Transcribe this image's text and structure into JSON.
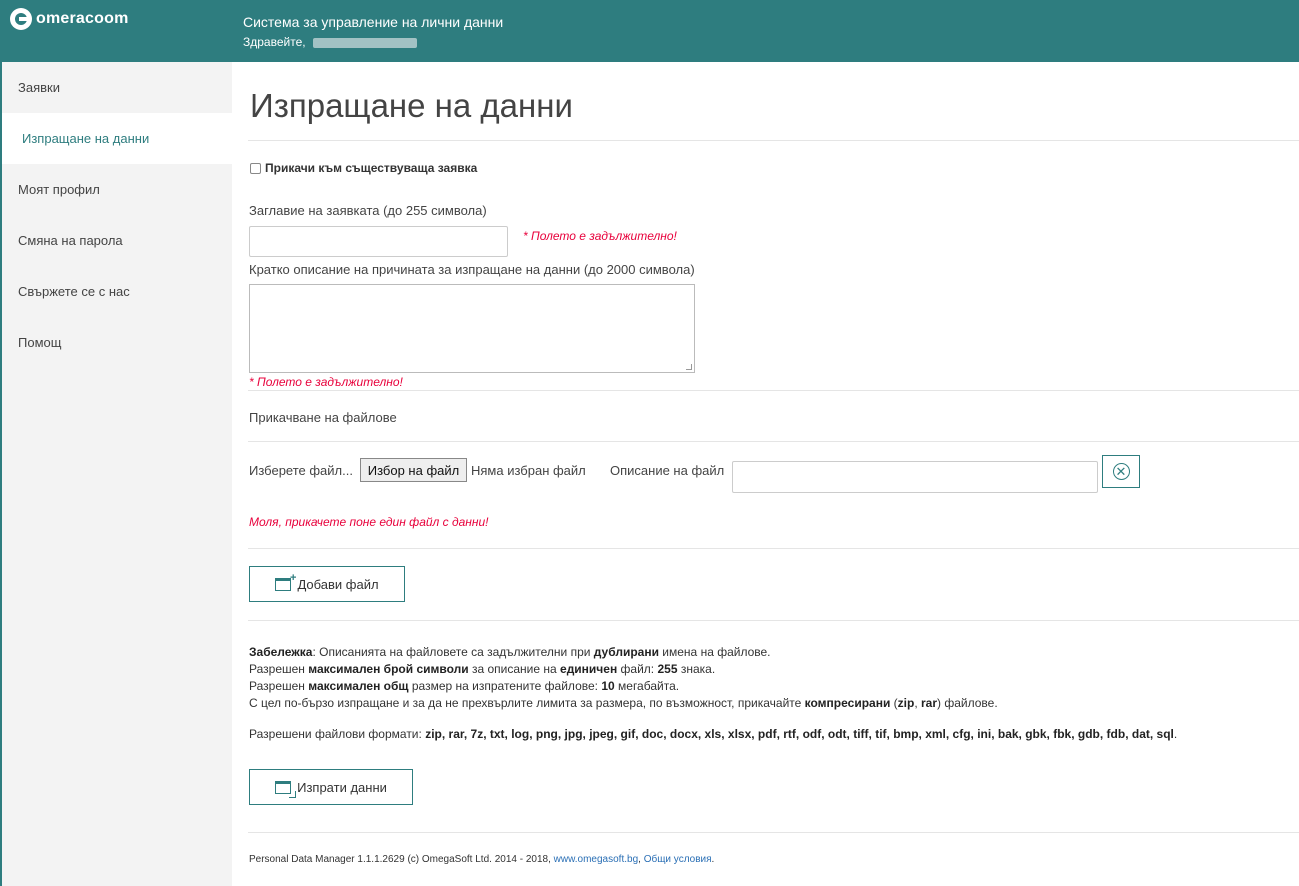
{
  "header": {
    "logo_text": "omeracoom",
    "system_title": "Система за управление на лични данни",
    "greeting": "Здравейте,"
  },
  "sidebar": {
    "items": [
      {
        "label": "Заявки"
      },
      {
        "label": "Изпращане на данни",
        "active": true
      },
      {
        "label": "Моят профил"
      },
      {
        "label": "Смяна на парола"
      },
      {
        "label": "Свържете се с нас"
      },
      {
        "label": "Помощ"
      }
    ]
  },
  "main": {
    "page_title": "Изпращане на данни",
    "attach_existing_label": "Прикачи към съществуваща заявка",
    "request_title_label": "Заглавие на заявката (до 255 символа)",
    "request_title_value": "",
    "required_error": "* Полето е задължително!",
    "description_label": "Кратко описание на причината за изпращане на данни (до 2000 символа)",
    "description_value": "",
    "attachments_heading": "Прикачване на файлове",
    "choose_file_label": "Изберете файл...",
    "file_button_label": "Избор на файл",
    "no_file_text": "Няма избран файл",
    "file_description_label": "Описание на файл",
    "file_description_value": "",
    "file_error": "Моля, прикачете поне един файл с данни!",
    "add_file_button": "Добави файл",
    "notes": {
      "note_prefix": "Забележка",
      "note_1a": ": Описанията на файловете са задължителни при ",
      "note_1b": "дублирани",
      "note_1c": " имена на файлове.",
      "note_2a": "Разрешен ",
      "note_2b": "максимален брой символи",
      "note_2c": " за описание на ",
      "note_2d": "единичен",
      "note_2e": " файл: ",
      "note_2f": "255",
      "note_2g": " знака.",
      "note_3a": "Разрешен ",
      "note_3b": "максимален общ",
      "note_3c": " размер на изпратените файлове: ",
      "note_3d": "10",
      "note_3e": " мегабайта.",
      "note_4a": "С цел по-бързо изпращане и за да не прехвърлите лимита за размера, по възможност, прикачайте ",
      "note_4b": "компресирани",
      "note_4c": " (",
      "note_4d": "zip",
      "note_4e": ", ",
      "note_4f": "rar",
      "note_4g": ") файлове."
    },
    "formats_label": "Разрешени файлови формати: ",
    "formats_list": "zip, rar, 7z, txt, log, png, jpg, jpeg, gif, doc, docx, xls, xlsx, pdf, rtf, odf, odt, tiff, tif, bmp, xml, cfg, ini, bak, gbk, fbk, gdb, fdb, dat, sql",
    "formats_end": ".",
    "send_button": "Изпрати данни"
  },
  "footer": {
    "text": "Personal Data Manager 1.1.1.2629 (c) OmegaSoft Ltd. 2014 - 2018, ",
    "link_site": "www.omegasoft.bg",
    "separator": ", ",
    "link_terms": "Общи условия",
    "end": "."
  },
  "colors": {
    "brand": "#2e7d7f",
    "error": "#e8003b",
    "link": "#2a6fb5",
    "sidebar_bg": "#f3f3f3"
  },
  "icons": [
    "logo-icon",
    "checkbox-icon",
    "remove-file-icon",
    "add-file-icon",
    "send-data-icon"
  ]
}
